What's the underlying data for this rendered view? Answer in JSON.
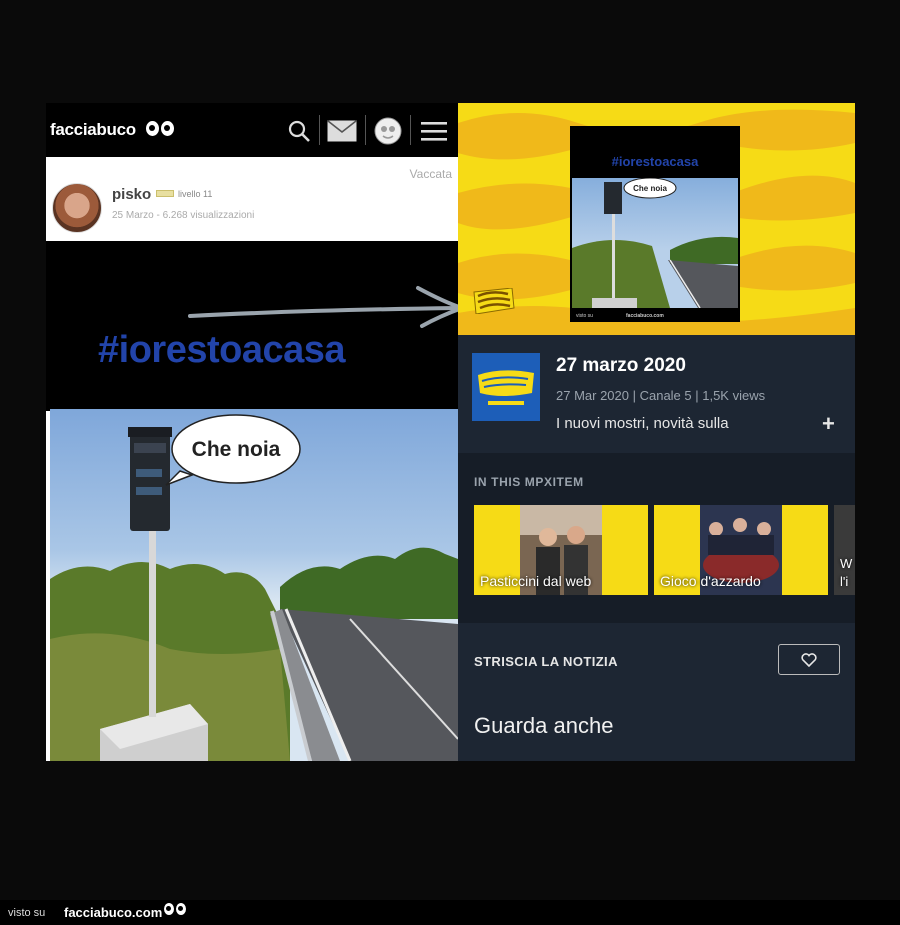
{
  "left_post": {
    "brand": "facciabuco",
    "category": "Vaccata",
    "user": {
      "name": "pisko",
      "level": "livello 11",
      "meta": "25 Marzo - 6.268 visualizzazioni"
    },
    "hashtag": "#iorestoacasa",
    "speech_bubble": "Che noia"
  },
  "right_app": {
    "thumbnail": {
      "hashtag": "#iorestoacasa",
      "speech_bubble": "Che noia",
      "footer_left": "visto su",
      "footer_right": "facciabuco.com"
    },
    "episode": {
      "title": "27 marzo 2020",
      "meta": "27 Mar 2020 | Canale 5 | 1,5K views",
      "description": "I nuovi mostri, novità sulla",
      "plus": "+"
    },
    "in_this": {
      "label": "IN THIS MPXITEM",
      "cards": [
        {
          "caption": "Pasticcini dal web"
        },
        {
          "caption": "Gioco d'azzardo"
        },
        {
          "caption": "W\nl'i"
        }
      ]
    },
    "show": {
      "label": "STRISCIA LA NOTIZIA"
    },
    "see_also": "Guarda anche"
  },
  "footer": {
    "visto_su": "visto su",
    "site": "facciabuco.com"
  },
  "colors": {
    "background": "#0a0a0a",
    "app_dark": "#1d2633",
    "banner_yellow": "#f6db16",
    "hashtag_blue": "#2244aa"
  }
}
